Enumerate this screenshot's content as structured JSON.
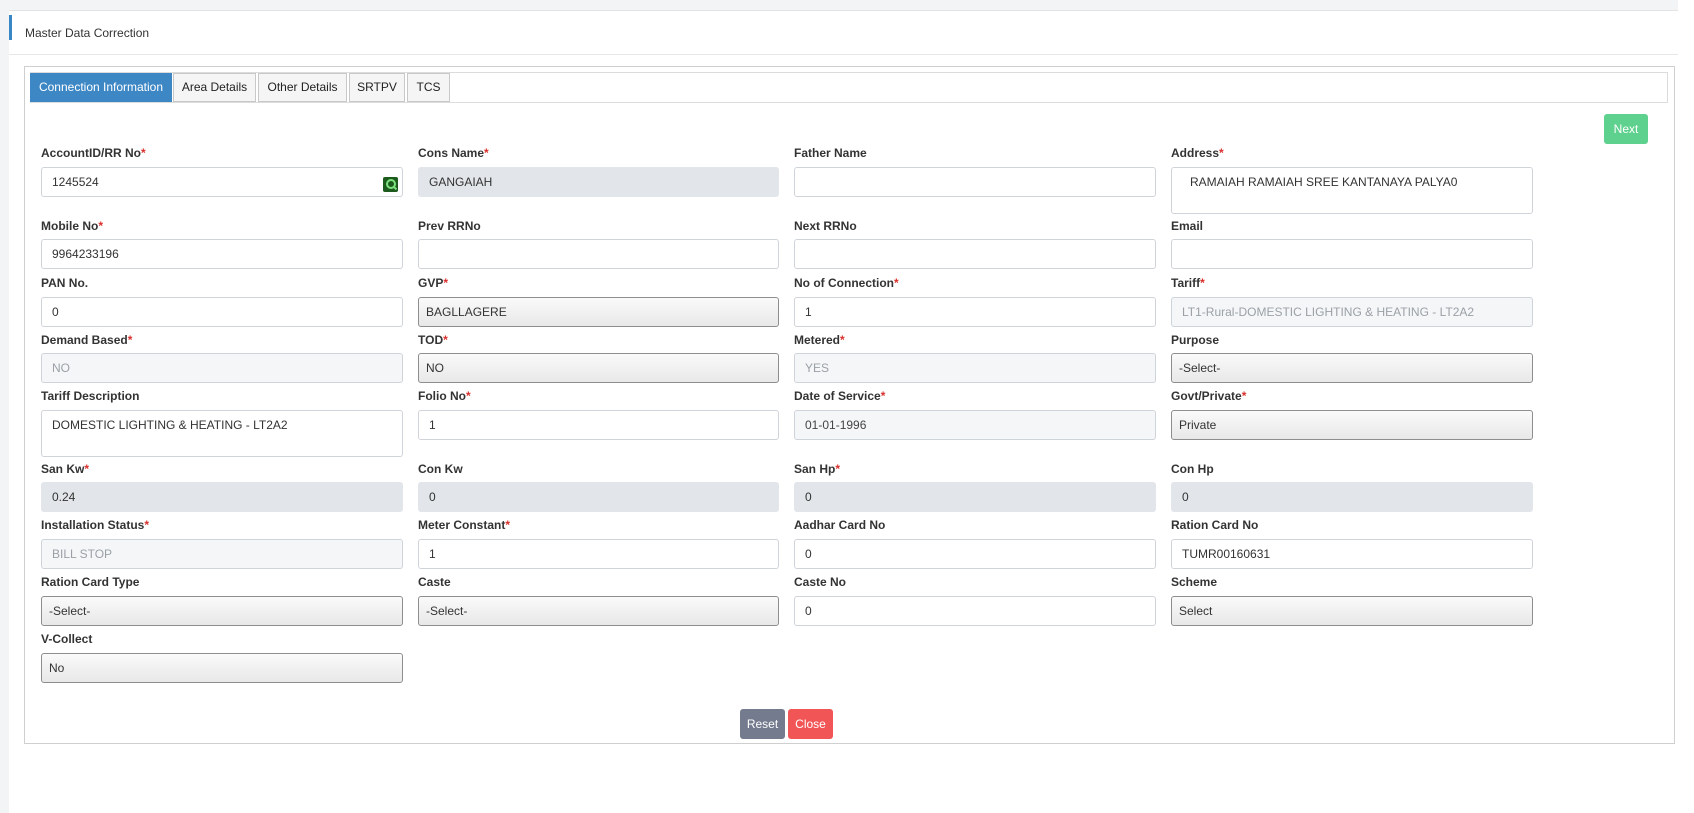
{
  "header": {
    "title": "Master Data Correction"
  },
  "tabs": [
    "Connection Information",
    "Area Details",
    "Other Details",
    "SRTPV",
    "TCS"
  ],
  "next_label": "Next",
  "fields": {
    "account_id": {
      "label": "AccountID/RR No",
      "value": "1245524"
    },
    "cons_name": {
      "label": "Cons Name",
      "value": "GANGAIAH"
    },
    "father_name": {
      "label": "Father Name",
      "value": ""
    },
    "address": {
      "label": "Address",
      "value": "RAMAIAH RAMAIAH SREE KANTANAYA PALYA0"
    },
    "mobile_no": {
      "label": "Mobile No",
      "value": "9964233196"
    },
    "prev_rrno": {
      "label": "Prev RRNo",
      "value": ""
    },
    "next_rrno": {
      "label": "Next RRNo",
      "value": ""
    },
    "email": {
      "label": "Email",
      "value": ""
    },
    "pan_no": {
      "label": "PAN No.",
      "value": "0"
    },
    "gvp": {
      "label": "GVP",
      "value": "BAGLLAGERE"
    },
    "no_of_connection": {
      "label": "No of Connection",
      "value": "1"
    },
    "tariff": {
      "label": "Tariff",
      "value": "LT1-Rural-DOMESTIC LIGHTING & HEATING - LT2A2"
    },
    "demand_based": {
      "label": "Demand Based",
      "value": "NO"
    },
    "tod": {
      "label": "TOD",
      "value": "NO"
    },
    "metered": {
      "label": "Metered",
      "value": "YES"
    },
    "purpose": {
      "label": "Purpose",
      "value": "-Select-"
    },
    "tariff_description": {
      "label": "Tariff Description",
      "value": "DOMESTIC LIGHTING & HEATING - LT2A2"
    },
    "folio_no": {
      "label": "Folio No",
      "value": "1"
    },
    "date_of_service": {
      "label": "Date of Service",
      "value": "01-01-1996"
    },
    "govt_private": {
      "label": "Govt/Private",
      "value": "Private"
    },
    "san_kw": {
      "label": "San Kw",
      "value": "0.24"
    },
    "con_kw": {
      "label": "Con Kw",
      "value": "0"
    },
    "san_hp": {
      "label": "San Hp",
      "value": "0"
    },
    "con_hp": {
      "label": "Con Hp",
      "value": "0"
    },
    "installation_status": {
      "label": "Installation Status",
      "value": "BILL STOP"
    },
    "meter_constant": {
      "label": "Meter Constant",
      "value": "1"
    },
    "aadhar_card_no": {
      "label": "Aadhar Card No",
      "value": "0"
    },
    "ration_card_no": {
      "label": "Ration Card No",
      "value": "TUMR00160631"
    },
    "ration_card_type": {
      "label": "Ration Card Type",
      "value": "-Select-"
    },
    "caste": {
      "label": "Caste",
      "value": "-Select-"
    },
    "caste_no": {
      "label": "Caste No",
      "value": "0"
    },
    "scheme": {
      "label": "Scheme",
      "value": "Select"
    },
    "v_collect": {
      "label": "V-Collect",
      "value": "No"
    }
  },
  "required_marker": "*",
  "buttons": {
    "reset": "Reset",
    "close": "Close"
  },
  "colors": {
    "tab_active": "#3d87c5",
    "next": "#5fd18f",
    "reset": "#757b8e",
    "close": "#f25555",
    "required": "#d9302c"
  }
}
